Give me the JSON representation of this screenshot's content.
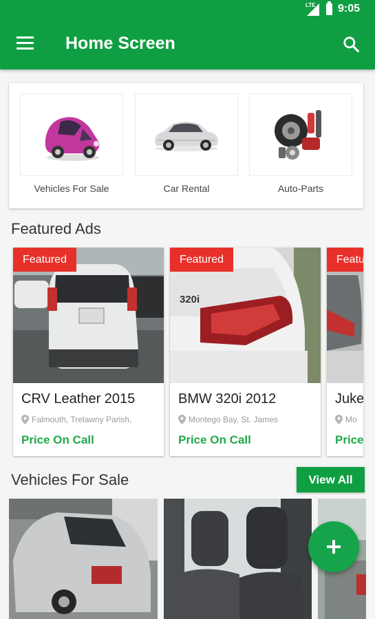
{
  "status_bar": {
    "network": "LTE",
    "time": "9:05"
  },
  "app_bar": {
    "title": "Home Screen"
  },
  "categories": [
    {
      "label": "Vehicles For Sale",
      "icon": "pink-car-icon"
    },
    {
      "label": "Car Rental",
      "icon": "silver-sedan-icon"
    },
    {
      "label": "Auto-Parts",
      "icon": "auto-parts-icon"
    }
  ],
  "featured": {
    "title": "Featured Ads",
    "badge": "Featured",
    "ads": [
      {
        "title": "CRV Leather 2015",
        "location": "Falmouth, Trelawny Parish,",
        "price": "Price On Call"
      },
      {
        "title": "BMW 320i 2012",
        "location": "Montego Bay, St. James",
        "price": "Price On Call"
      },
      {
        "title": "Juke",
        "location": "Mo",
        "price": "Price"
      }
    ]
  },
  "vehicles": {
    "title": "Vehicles For Sale",
    "view_all": "View All"
  },
  "fab": {
    "icon": "plus-icon"
  },
  "colors": {
    "primary": "#0f9f42",
    "badge": "#e8302a",
    "price": "#22a84a"
  }
}
